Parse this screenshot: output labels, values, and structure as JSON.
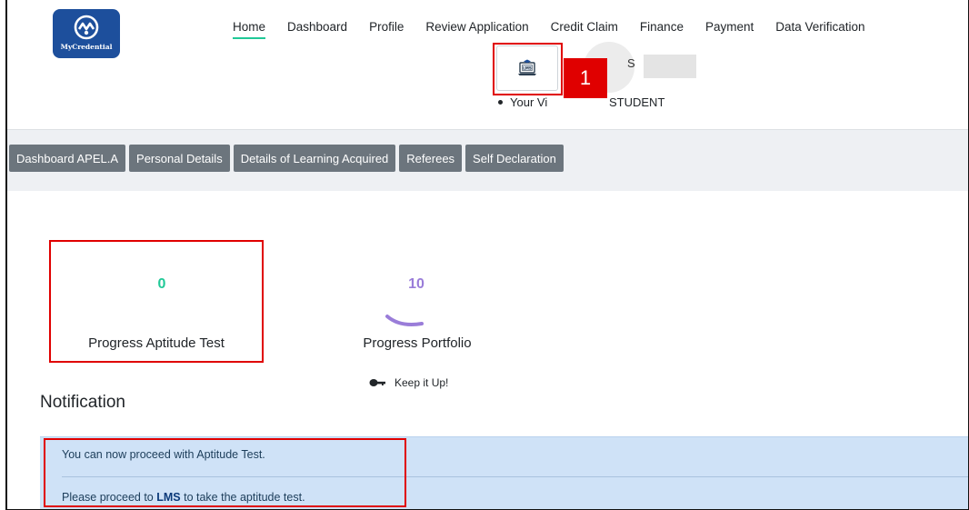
{
  "brand": {
    "logo_text": "MyCredential",
    "color": "#1d4f9c"
  },
  "nav": {
    "items": [
      "Home",
      "Dashboard",
      "Profile",
      "Review Application",
      "Credit Claim",
      "Finance",
      "Payment",
      "Data Verification"
    ],
    "active": "Home",
    "active_color": "#20c997"
  },
  "header": {
    "lms_button_icon": "lms-laptop-icon",
    "annotation_number": "1",
    "name_visible_fragment": "S",
    "view_prefix": "Your Vi",
    "view_role": "STUDENT"
  },
  "tabs": [
    "Dashboard APEL.A",
    "Personal Details",
    "Details of Learning Acquired",
    "Referees",
    "Self Declaration"
  ],
  "progress": {
    "aptitude": {
      "value": "0",
      "label": "Progress Aptitude Test",
      "color": "#20c997"
    },
    "portfolio": {
      "value": "10",
      "label": "Progress Portfolio",
      "color": "#9a7dd9"
    }
  },
  "encouragement": "Keep it Up!",
  "notification": {
    "title": "Notification",
    "line1": "You can now proceed with Aptitude Test.",
    "line2_prefix": "Please proceed to ",
    "line2_link": "LMS",
    "line2_suffix": " to take the aptitude test."
  },
  "highlight_color": "#e00000"
}
